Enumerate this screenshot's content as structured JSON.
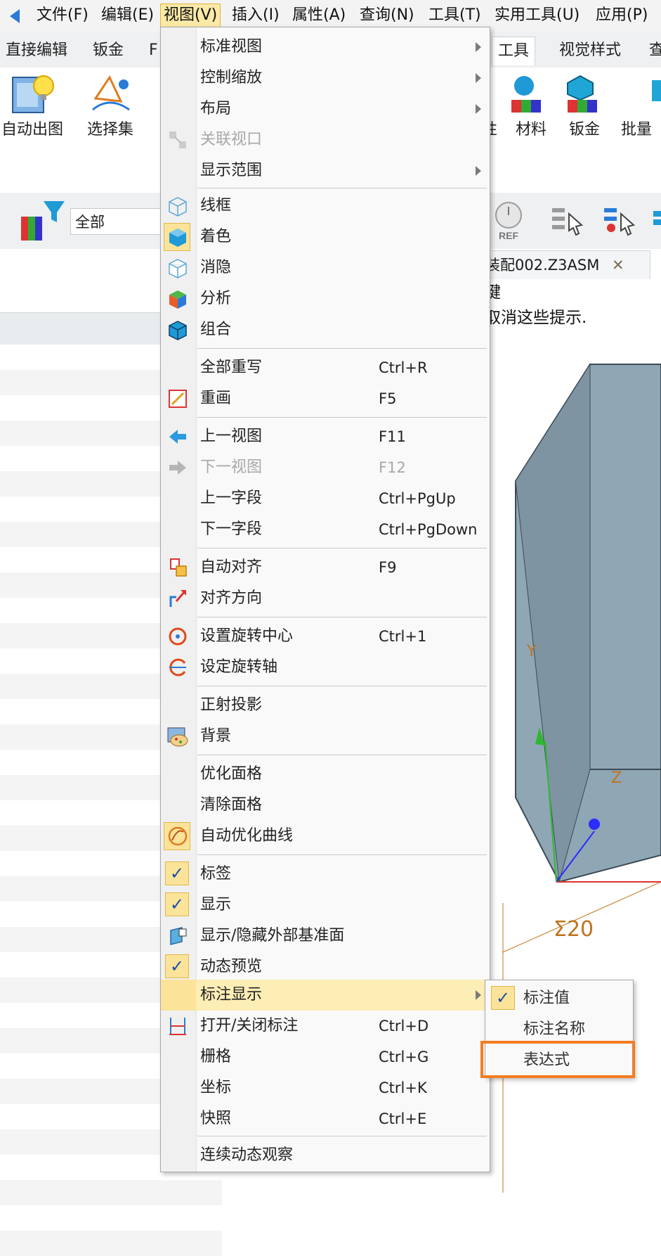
{
  "menubar": {
    "items": [
      "文件(F)",
      "编辑(E)",
      "视图(V)",
      "插入(I)",
      "属性(A)",
      "查询(N)",
      "工具(T)",
      "实用工具(U)",
      "应用(P)"
    ]
  },
  "ribbon": {
    "tabs_left": [
      "直接编辑",
      "钣金",
      "F"
    ],
    "tabs_right": [
      "工具",
      "视觉样式",
      "查"
    ],
    "buttons_left": [
      "自动出图",
      "选择集"
    ],
    "buttons_right": [
      "材料",
      "钣金",
      "批量"
    ],
    "partial_right": "性"
  },
  "filter": {
    "value": "全部"
  },
  "doc_tab": {
    "title": "装配002.Z3ASM",
    "close": "✕"
  },
  "hints": [
    "键",
    "取消这些提示."
  ],
  "viewport": {
    "dim_label": "Σ20",
    "axis_y": "Y",
    "axis_z": "Z"
  },
  "view_menu": {
    "items": [
      {
        "label": "标准视图",
        "shortcut": "",
        "submenu": true
      },
      {
        "label": "控制缩放",
        "shortcut": "",
        "submenu": true
      },
      {
        "label": "布局",
        "shortcut": "",
        "submenu": true
      },
      {
        "label": "关联视口",
        "shortcut": "",
        "disabled": true
      },
      {
        "label": "显示范围",
        "shortcut": "",
        "submenu": true
      },
      {
        "label": "线框",
        "shortcut": ""
      },
      {
        "label": "着色",
        "shortcut": ""
      },
      {
        "label": "消隐",
        "shortcut": ""
      },
      {
        "label": "分析",
        "shortcut": ""
      },
      {
        "label": "组合",
        "shortcut": ""
      },
      {
        "label": "全部重写",
        "shortcut": "Ctrl+R"
      },
      {
        "label": "重画",
        "shortcut": "F5"
      },
      {
        "label": "上一视图",
        "shortcut": "F11"
      },
      {
        "label": "下一视图",
        "shortcut": "F12",
        "disabled": true
      },
      {
        "label": "上一字段",
        "shortcut": "Ctrl+PgUp"
      },
      {
        "label": "下一字段",
        "shortcut": "Ctrl+PgDown"
      },
      {
        "label": "自动对齐",
        "shortcut": "F9"
      },
      {
        "label": "对齐方向",
        "shortcut": ""
      },
      {
        "label": "设置旋转中心",
        "shortcut": "Ctrl+1"
      },
      {
        "label": "设定旋转轴",
        "shortcut": ""
      },
      {
        "label": "正射投影",
        "shortcut": ""
      },
      {
        "label": "背景",
        "shortcut": ""
      },
      {
        "label": "优化面格",
        "shortcut": ""
      },
      {
        "label": "清除面格",
        "shortcut": ""
      },
      {
        "label": "自动优化曲线",
        "shortcut": ""
      },
      {
        "label": "标签",
        "shortcut": "",
        "checked": true
      },
      {
        "label": "显示",
        "shortcut": "",
        "checked": true
      },
      {
        "label": "显示/隐藏外部基准面",
        "shortcut": ""
      },
      {
        "label": "动态预览",
        "shortcut": "",
        "checked": true
      },
      {
        "label": "标注显示",
        "shortcut": "",
        "submenu": true,
        "highlighted": true
      },
      {
        "label": "打开/关闭标注",
        "shortcut": "Ctrl+D"
      },
      {
        "label": "栅格",
        "shortcut": "Ctrl+G"
      },
      {
        "label": "坐标",
        "shortcut": "Ctrl+K"
      },
      {
        "label": "快照",
        "shortcut": "Ctrl+E"
      },
      {
        "label": "连续动态观察",
        "shortcut": ""
      }
    ]
  },
  "annotation_submenu": {
    "items": [
      {
        "label": "标注值",
        "checked": true
      },
      {
        "label": "标注名称",
        "checked": false
      },
      {
        "label": "表达式",
        "checked": false,
        "emphasized": true
      }
    ]
  },
  "colors": {
    "menu_highlight": "#fdeeb5",
    "emphasis_box": "#f47d20",
    "model_face": "#8fa6b4"
  }
}
